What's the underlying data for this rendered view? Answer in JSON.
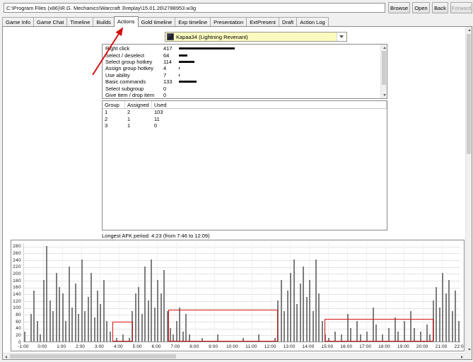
{
  "toolbar": {
    "path_value": "C:\\Program Files (x86)\\R.G. Mechanics\\Warcraft 3\\replay\\15.01.26\\2788953.w3g",
    "browse_label": "Browse",
    "open_label": "Open",
    "back_label": "Back",
    "forward_label": "Forward"
  },
  "tabs": [
    "Game Info",
    "Game Chat",
    "Timeline",
    "Builds",
    "Actions",
    "Gold timeline",
    "Exp timeline",
    "Presentation",
    "ExtPresent",
    "Draft",
    "Action Log"
  ],
  "active_tab": "Actions",
  "player_select": {
    "value": "Kapaa34 (Lightning Revenant)"
  },
  "action_stats": [
    {
      "label": "Right click",
      "value": 417
    },
    {
      "label": "Select / deselect",
      "value": 64
    },
    {
      "label": "Select group hotkey",
      "value": 114
    },
    {
      "label": "Assign group hotkey",
      "value": 4
    },
    {
      "label": "Use ability",
      "value": 7
    },
    {
      "label": "Basic commands",
      "value": 133
    },
    {
      "label": "Select subgroup",
      "value": 0
    },
    {
      "label": "Give item / drop item",
      "value": 0
    }
  ],
  "groups_table": {
    "headers": [
      "Group",
      "Assigned",
      "Used"
    ],
    "rows": [
      [
        "1",
        "2",
        "103"
      ],
      [
        "2",
        "1",
        "11"
      ],
      [
        "3",
        "1",
        "0"
      ]
    ]
  },
  "afk_label": "Longest AFK period: 4:23 (from 7:46 to 12:09)",
  "chart_data": {
    "type": "bar",
    "title": "",
    "xlabel": "",
    "ylabel": "",
    "ylim": [
      0,
      290
    ],
    "y_ticks": [
      0,
      20,
      40,
      60,
      80,
      100,
      120,
      140,
      160,
      180,
      200,
      220,
      240,
      260,
      280
    ],
    "x_tick_labels": [
      "-1:00",
      "0:00",
      "1:00",
      "2:00",
      "3:00",
      "4:00",
      "5:00",
      "6:00",
      "7:00",
      "8:00",
      "9:00",
      "10:00",
      "11:00",
      "12:00",
      "13:00",
      "14:00",
      "15:00",
      "16:00",
      "17:00",
      "18:00",
      "19:00",
      "20:00",
      "21:00",
      "22:00"
    ],
    "bucket_seconds": 10,
    "bar_color": "#7d7d7d",
    "grid": true,
    "values": [
      30,
      0,
      80,
      150,
      60,
      20,
      180,
      280,
      120,
      90,
      200,
      160,
      140,
      60,
      220,
      100,
      170,
      80,
      240,
      90,
      130,
      200,
      70,
      150,
      110,
      180,
      60,
      30,
      0,
      10,
      0,
      20,
      0,
      10,
      90,
      140,
      160,
      80,
      220,
      120,
      240,
      100,
      180,
      140,
      210,
      90,
      40,
      20,
      60,
      100,
      30,
      80,
      20,
      0,
      0,
      0,
      10,
      0,
      0,
      0,
      0,
      20,
      0,
      0,
      0,
      0,
      0,
      0,
      0,
      10,
      0,
      0,
      0,
      0,
      20,
      0,
      0,
      0,
      0,
      10,
      120,
      180,
      90,
      150,
      200,
      240,
      110,
      170,
      220,
      130,
      180,
      90,
      240,
      140,
      60,
      20,
      10,
      0,
      30,
      0,
      20,
      0,
      80,
      40,
      0,
      60,
      20,
      0,
      30,
      0,
      100,
      50,
      0,
      20,
      0,
      40,
      0,
      70,
      30,
      0,
      60,
      0,
      90,
      40,
      0,
      30,
      0,
      50,
      20,
      120,
      160,
      100,
      200,
      140,
      180,
      90,
      150,
      60
    ]
  },
  "annotations": {
    "color": "#d41111",
    "arrow_target": "tab-actions",
    "boxes": [
      {
        "t0": 3.65,
        "t1": 4.75,
        "apm": 58
      },
      {
        "t0": 6.6,
        "t1": 12.35,
        "apm": 94
      },
      {
        "t0": 14.8,
        "t1": 20.55,
        "apm": 66
      }
    ]
  }
}
